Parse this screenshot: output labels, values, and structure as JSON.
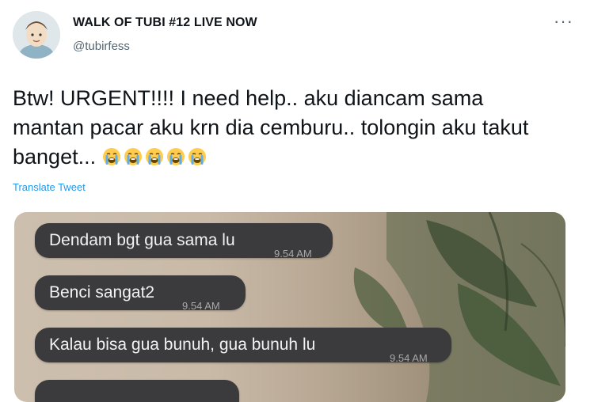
{
  "author": {
    "display_name": "WALK OF TUBI #12 LIVE NOW",
    "handle": "@tubirfess"
  },
  "more_label": "···",
  "tweet": {
    "line1": "Btw! URGENT!!!! I need help.. aku diancam sama",
    "line2": "mantan pacar aku krn dia cemburu.. tolongin aku takut",
    "line3": "banget...",
    "emoji_name": "loudly-crying-face-icon",
    "emoji_count": 5
  },
  "translate_label": "Translate Tweet",
  "media": {
    "messages": [
      {
        "text": "Dendam bgt gua sama lu",
        "time": "9.54 AM"
      },
      {
        "text": "Benci sangat2",
        "time": "9.54 AM"
      },
      {
        "text": "Kalau bisa gua bunuh, gua bunuh lu",
        "time": "9.54 AM"
      }
    ]
  },
  "colors": {
    "link": "#1d9bf0",
    "bubble": "#3b3b3d",
    "text": "#0f1419",
    "muted": "#536471"
  }
}
